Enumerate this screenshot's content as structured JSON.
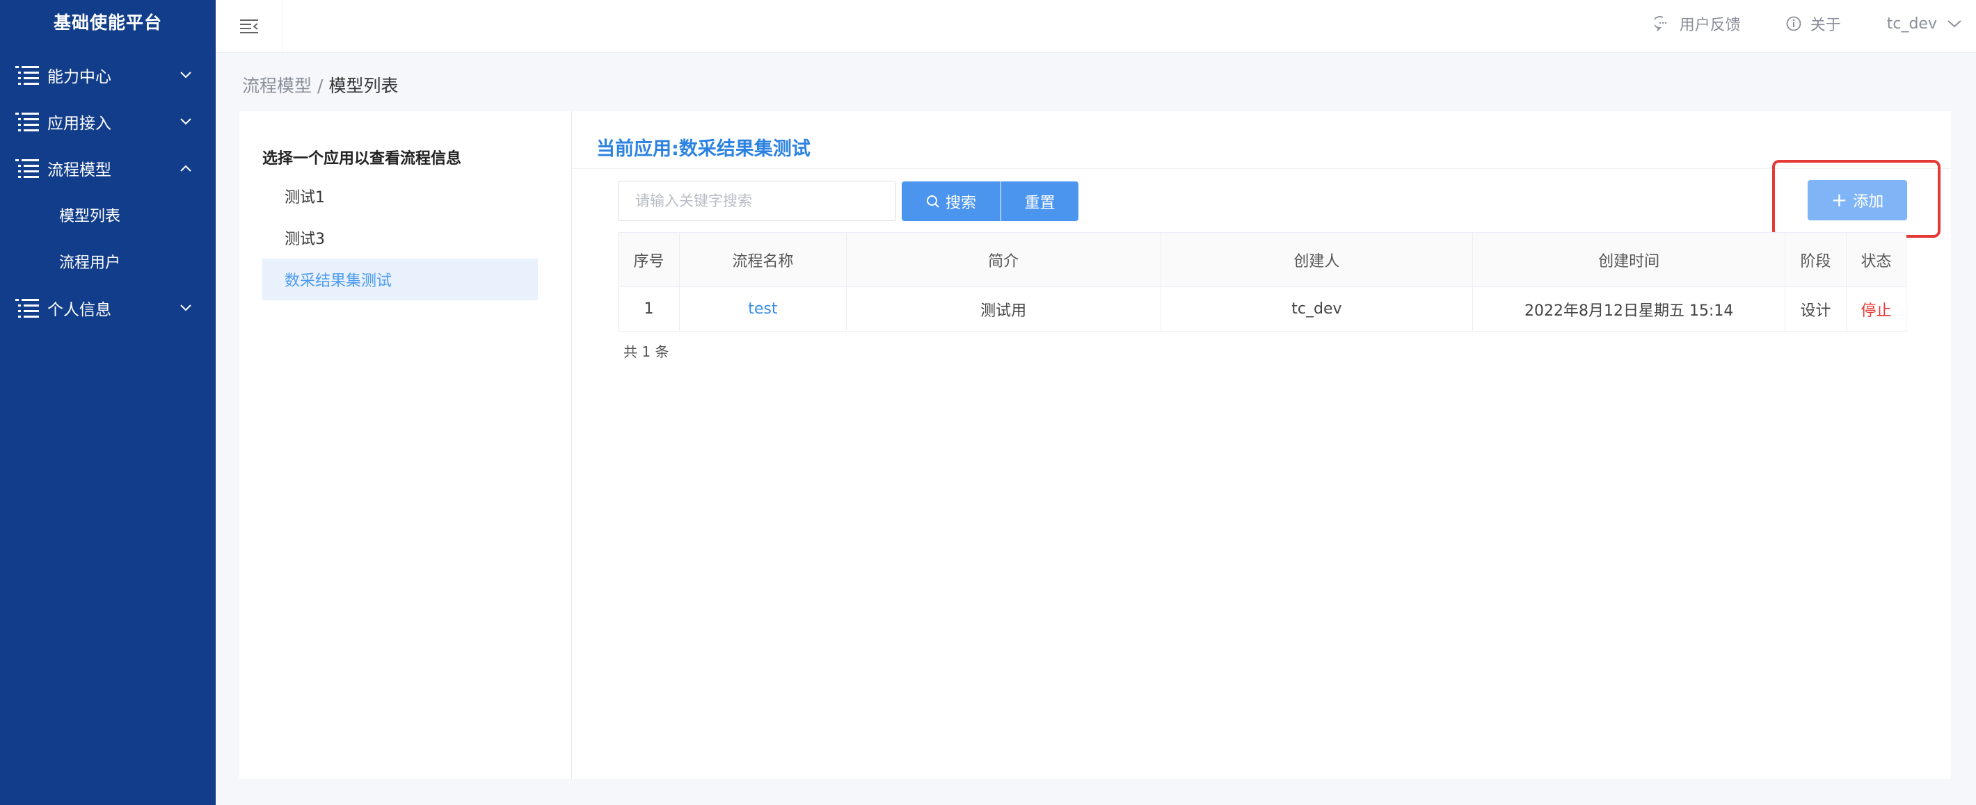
{
  "sidebar": {
    "brand": "基础使能平台",
    "menu": [
      {
        "label": "能力中心",
        "expanded": false
      },
      {
        "label": "应用接入",
        "expanded": false
      },
      {
        "label": "流程模型",
        "expanded": true,
        "children": [
          "模型列表",
          "流程用户"
        ]
      },
      {
        "label": "个人信息",
        "expanded": false
      }
    ]
  },
  "topbar": {
    "collapse_icon": "menu-fold-icon",
    "feedback_label": "用户反馈",
    "about_label": "关于",
    "user": "tc_dev"
  },
  "breadcrumb": {
    "parent": "流程模型",
    "separator": "/",
    "current": "模型列表"
  },
  "left_panel": {
    "title": "选择一个应用以查看流程信息",
    "apps": [
      "测试1",
      "测试3",
      "数采结果集测试"
    ],
    "active_index": 2
  },
  "right_panel": {
    "title": "当前应用:数采结果集测试",
    "search": {
      "placeholder": "请输入关键字搜索",
      "value": ""
    },
    "search_button": "搜索",
    "reset_button": "重置",
    "add_button": "添加",
    "table": {
      "columns": [
        "序号",
        "流程名称",
        "简介",
        "创建人",
        "创建时间",
        "阶段",
        "状态"
      ],
      "rows": [
        [
          "1",
          "test",
          "测试用",
          "tc_dev",
          "2022年8月12日星期五 15:14",
          "设计",
          "停止"
        ]
      ]
    },
    "total": "共 1 条"
  },
  "colors": {
    "sidebar_bg": "#123d8a",
    "accent": "#4b95ef",
    "add_button": "#7fb4f6",
    "highlight": "#e53935",
    "status_stop": "#e53935"
  }
}
